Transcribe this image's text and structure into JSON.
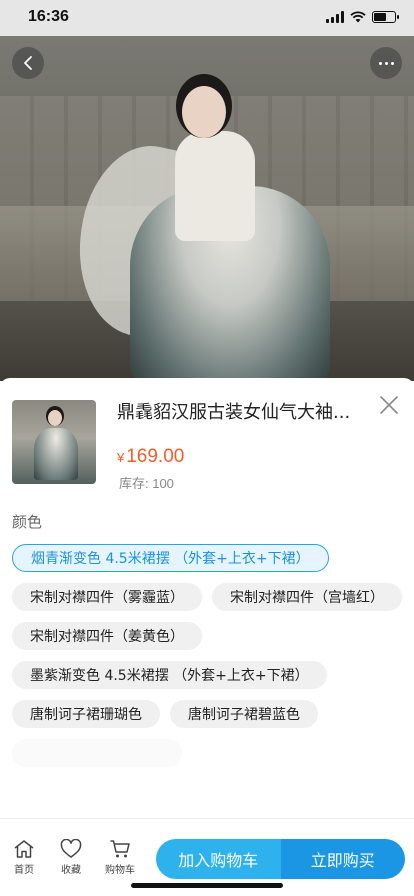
{
  "status_bar": {
    "time": "16:36",
    "battery_level": 0.6
  },
  "product": {
    "title": "鼎毳貂汉服古装女仙气大袖...",
    "currency": "¥",
    "price": "169.00",
    "stock": "库存: 100"
  },
  "spec": {
    "label": "颜色",
    "options": [
      {
        "label": "烟青渐变色 4.5米裙摆 （外套+上衣+下裙）",
        "selected": true
      },
      {
        "label": "宋制对襟四件（雾霾蓝）",
        "selected": false
      },
      {
        "label": "宋制对襟四件（宫墙红）",
        "selected": false
      },
      {
        "label": "宋制对襟四件（姜黄色）",
        "selected": false
      },
      {
        "label": "墨紫渐变色 4.5米裙摆 （外套+上衣+下裙）",
        "selected": false
      },
      {
        "label": "唐制诃子裙珊瑚色",
        "selected": false
      },
      {
        "label": "唐制诃子裙碧蓝色",
        "selected": false
      }
    ]
  },
  "bottom_nav": {
    "home": "首页",
    "favorite": "收藏",
    "cart": "购物车"
  },
  "actions": {
    "add_to_cart": "加入购物车",
    "buy_now": "立即购买"
  },
  "colors": {
    "accent": "#1a96e4",
    "accent_light": "#2db2ee",
    "price": "#f25d2a",
    "selected_bg": "#e5f4fd"
  }
}
